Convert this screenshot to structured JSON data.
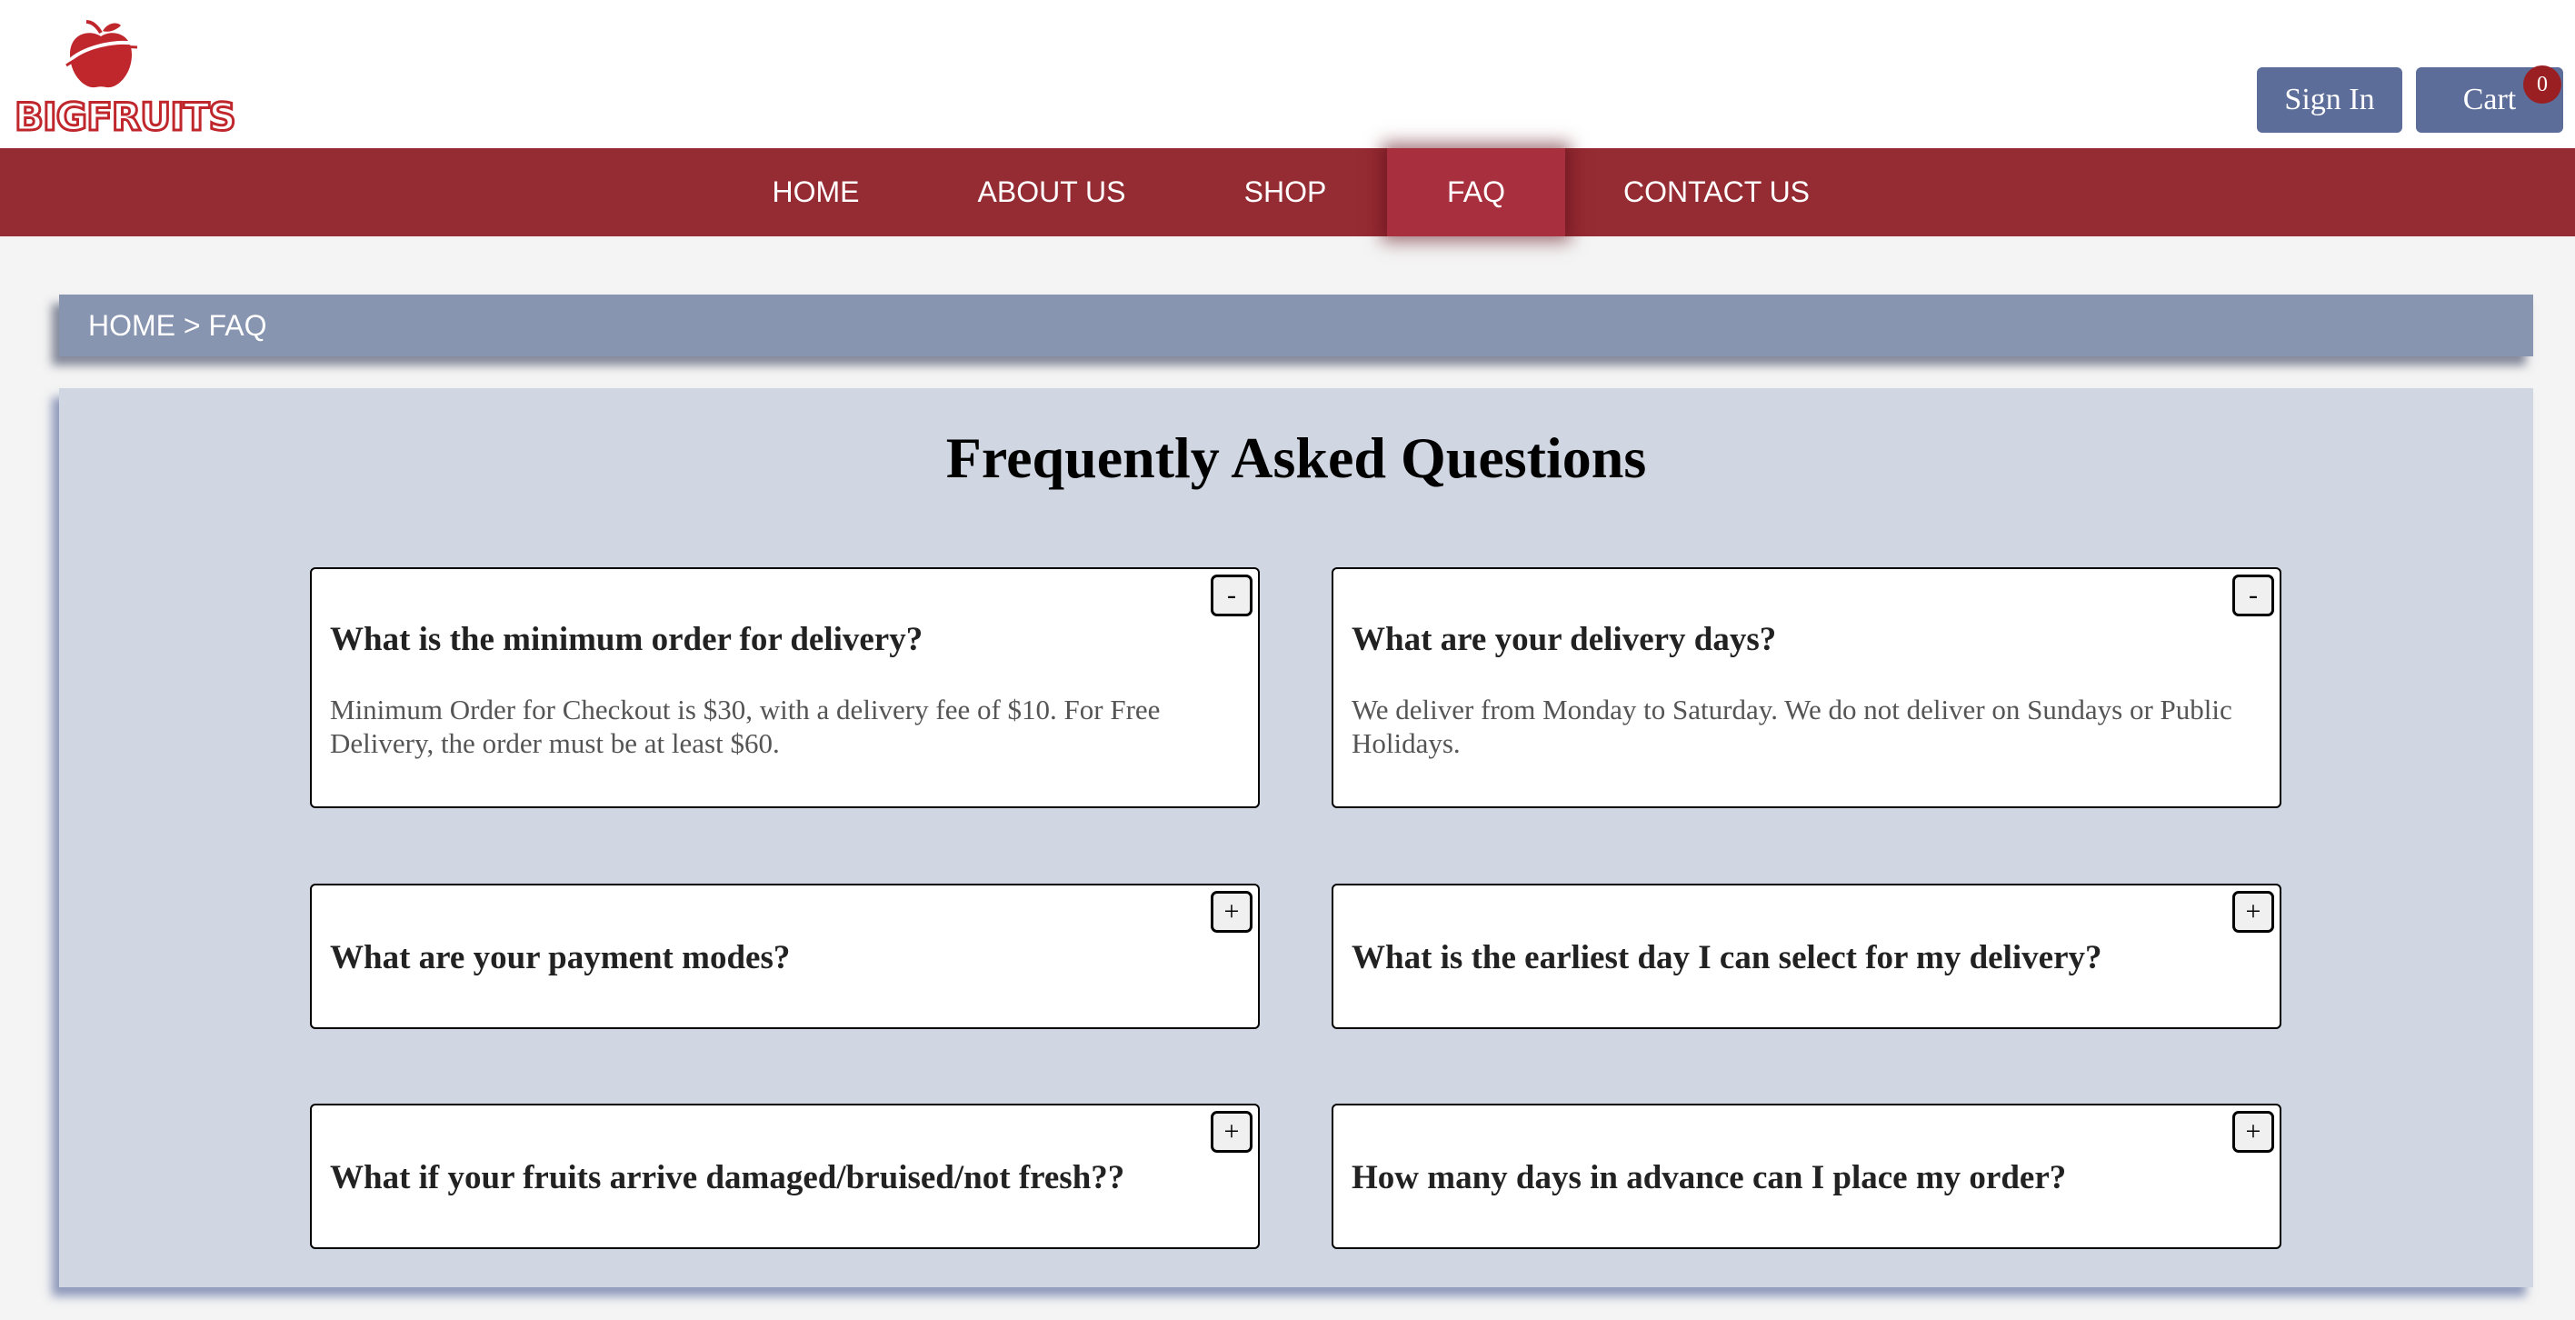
{
  "brand": {
    "name": "BIGFRUITS",
    "apple_color": "#c0272d"
  },
  "header": {
    "signin_label": "Sign In",
    "cart_label": "Cart",
    "cart_count": "0"
  },
  "nav": {
    "items": [
      {
        "label": "HOME"
      },
      {
        "label": "ABOUT US"
      },
      {
        "label": "SHOP"
      },
      {
        "label": "FAQ",
        "active": true
      },
      {
        "label": "CONTACT US"
      }
    ]
  },
  "breadcrumb": {
    "text": "HOME > FAQ"
  },
  "faq": {
    "title": "Frequently Asked Questions",
    "cards": [
      {
        "question": "What is the minimum order for delivery?",
        "answer": "Minimum Order for Checkout is $30, with a delivery fee of $10. For Free Delivery, the order must be at least $60.",
        "toggle": "-",
        "expanded": true
      },
      {
        "question": "What are your delivery days?",
        "answer": "We deliver from Monday to Saturday. We do not deliver on Sundays or Public Holidays.",
        "toggle": "-",
        "expanded": true
      },
      {
        "question": "What are your payment modes?",
        "toggle": "+",
        "expanded": false
      },
      {
        "question": "What is the earliest day I can select for my delivery?",
        "toggle": "+",
        "expanded": false
      },
      {
        "question": "What if your fruits arrive damaged/bruised/not fresh??",
        "toggle": "+",
        "expanded": false
      },
      {
        "question": "How many days in advance can I place my order?",
        "toggle": "+",
        "expanded": false
      }
    ]
  }
}
